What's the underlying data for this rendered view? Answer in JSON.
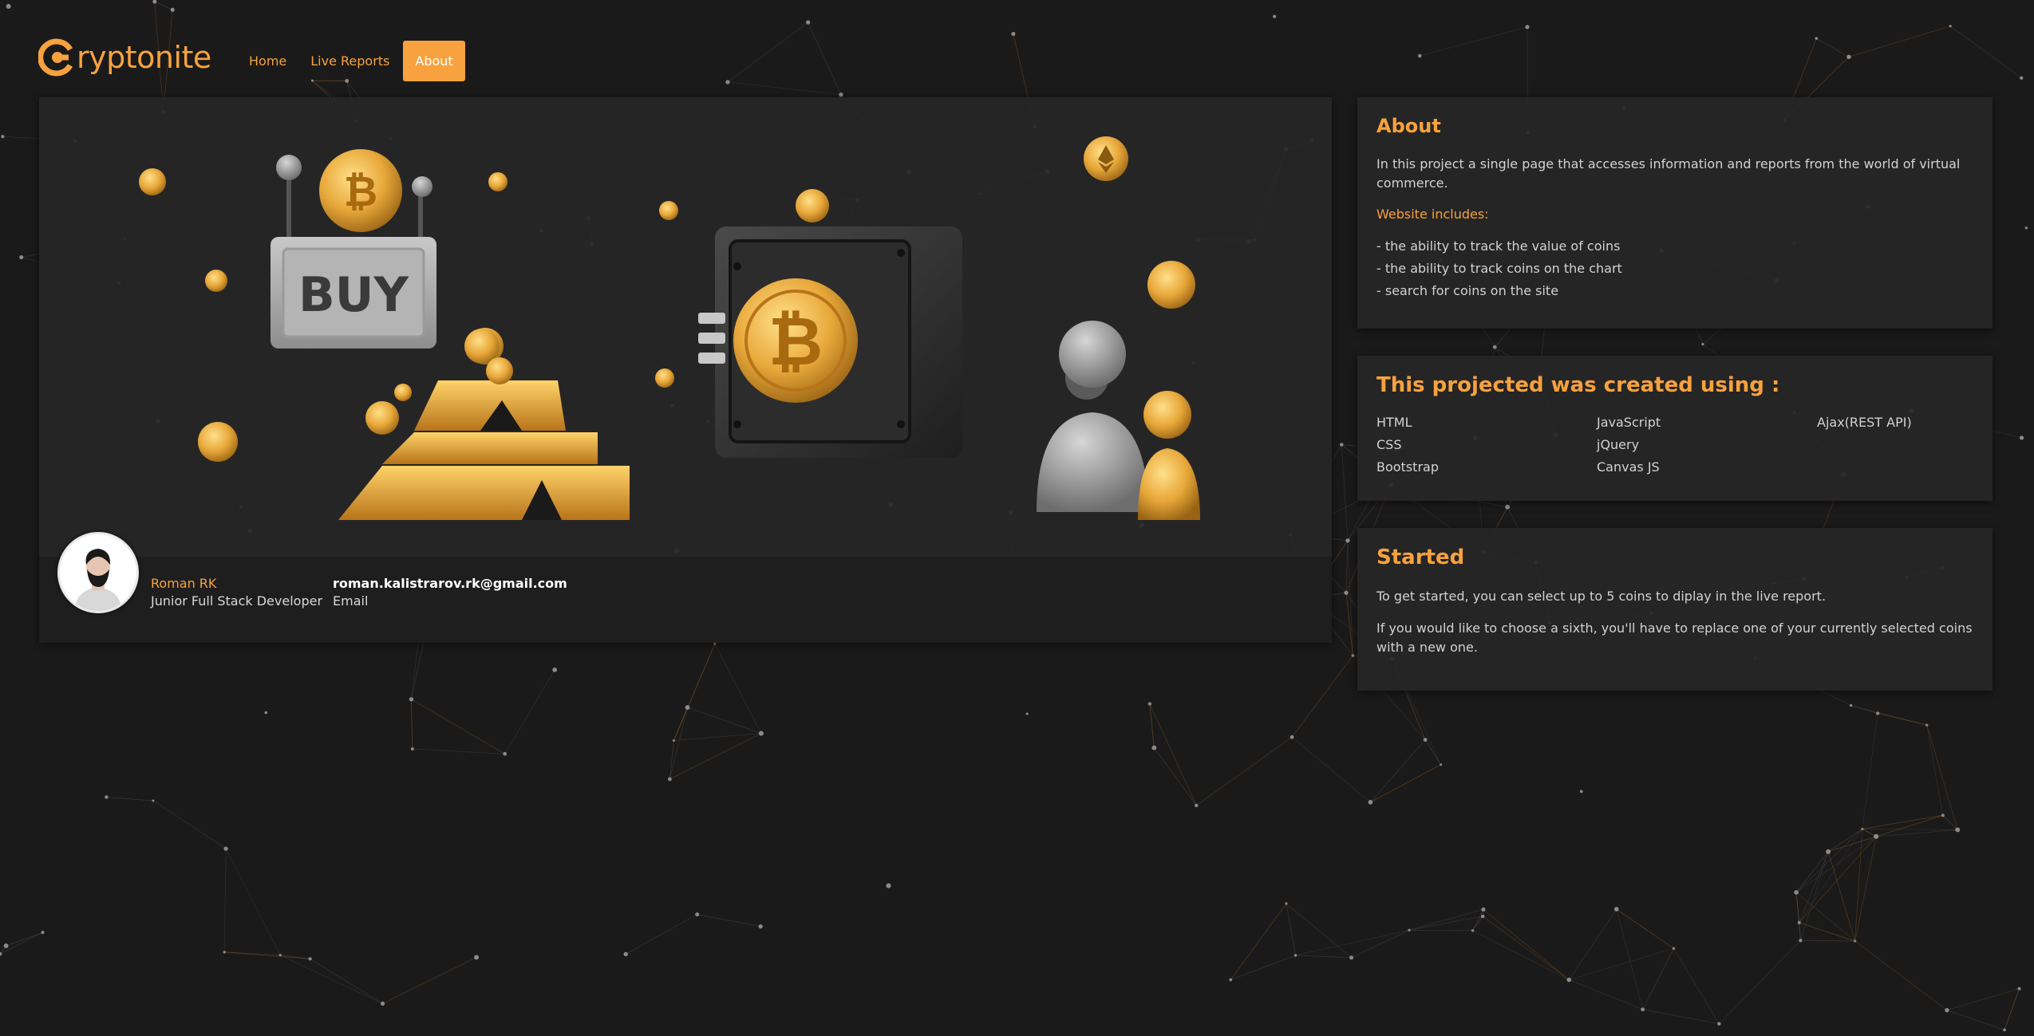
{
  "brand": {
    "name": "Cryptonite",
    "text_after_logo": "ryptonite",
    "accent_color": "#f7a23e"
  },
  "nav": {
    "items": [
      {
        "label": "Home",
        "active": false
      },
      {
        "label": "Live Reports",
        "active": false
      },
      {
        "label": "About",
        "active": true
      }
    ]
  },
  "hero": {
    "sign_text": "BUY",
    "illustration_icons": [
      "bitcoin-coin-icon",
      "buy-sign-icon",
      "gold-bars-icon",
      "safe-icon",
      "ethereum-coin-icon",
      "users-icon"
    ]
  },
  "profile": {
    "name": "Roman RK",
    "role": "Junior Full Stack Developer",
    "email": "roman.kalistrarov.rk@gmail.com",
    "email_label": "Email"
  },
  "about": {
    "title": "About",
    "intro": "In this project a single page that accesses information and reports from the world of virtual commerce.",
    "includes_label": "Website includes:",
    "items": [
      "- the ability to track the value of coins",
      "- the ability to track coins on the chart",
      "- search for coins on the site"
    ]
  },
  "tech": {
    "title": "This projected was created using :",
    "items": [
      "HTML",
      "JavaScript",
      "Ajax(REST API)",
      "CSS",
      "jQuery",
      "",
      "Bootstrap",
      "Canvas JS",
      ""
    ]
  },
  "started": {
    "title": "Started",
    "p1": "To get started, you can select up to 5 coins to diplay in the live report.",
    "p2": "If you would like to choose a sixth, you'll have to replace one of your currently selected coins with a new one."
  }
}
